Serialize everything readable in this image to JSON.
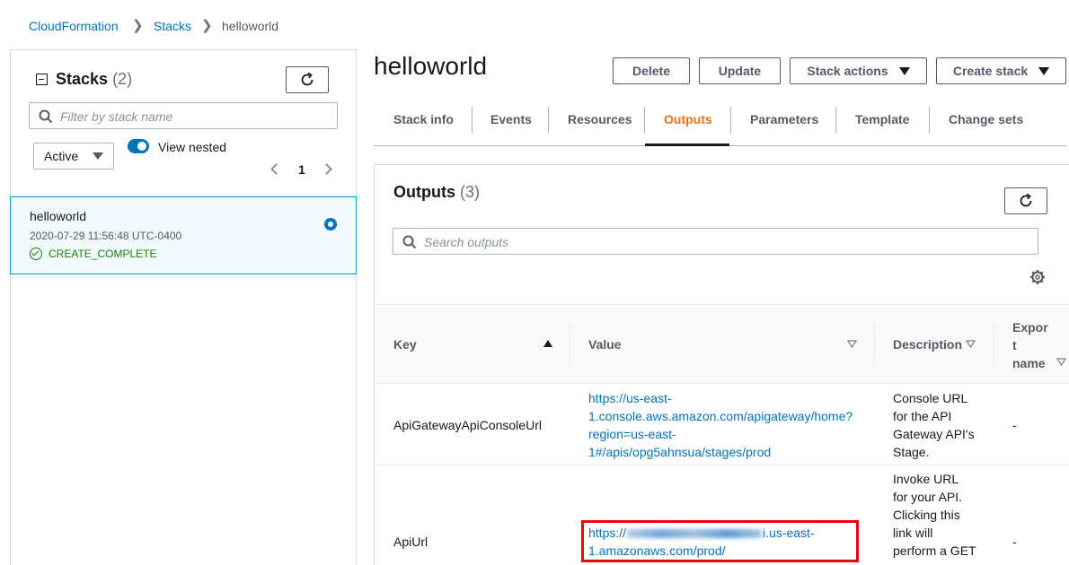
{
  "breadcrumb": {
    "items": [
      "CloudFormation",
      "Stacks",
      "helloworld"
    ]
  },
  "stacks_panel": {
    "title": "Stacks",
    "count": "(2)",
    "filter_placeholder": "Filter by stack name",
    "status_filter": "Active",
    "view_nested_label": "View nested",
    "view_nested_on": true,
    "page": "1",
    "selected_stack": {
      "name": "helloworld",
      "created": "2020-07-29 11:56:48 UTC-0400",
      "status": "CREATE_COMPLETE"
    }
  },
  "stack_header": {
    "title": "helloworld",
    "buttons": {
      "delete": "Delete",
      "update": "Update",
      "stack_actions": "Stack actions",
      "create_stack": "Create stack"
    }
  },
  "tabs": [
    "Stack info",
    "Events",
    "Resources",
    "Outputs",
    "Parameters",
    "Template",
    "Change sets"
  ],
  "active_tab": "Outputs",
  "outputs": {
    "title": "Outputs",
    "count": "(3)",
    "search_placeholder": "Search outputs",
    "columns": {
      "key": "Key",
      "value": "Value",
      "description": "Description",
      "export_line1": "Expor",
      "export_line2": "t",
      "export_line3": "name"
    },
    "rows": [
      {
        "key": "ApiGatewayApiConsoleUrl",
        "value_lines": [
          "https://us-east-",
          "1.console.aws.amazon.com/apigateway/home?",
          "region=us-east-",
          "1#/apis/opg5ahnsua/stages/prod"
        ],
        "description_lines": [
          "Console URL",
          "for the API",
          "Gateway API's",
          "Stage."
        ],
        "export": "-"
      },
      {
        "key": "ApiUrl",
        "value_start": "https://",
        "value_end": "i.us-east-",
        "value_line2": "1.amazonaws.com/prod/",
        "description_lines": [
          "Invoke URL",
          "for your API.",
          "Clicking this",
          "link will",
          "perform a GET"
        ],
        "export": "-"
      }
    ]
  },
  "colors": {
    "link": "#0073bb",
    "active_tab": "#ec7211",
    "success": "#1d8102",
    "highlight": "#e8070d"
  }
}
